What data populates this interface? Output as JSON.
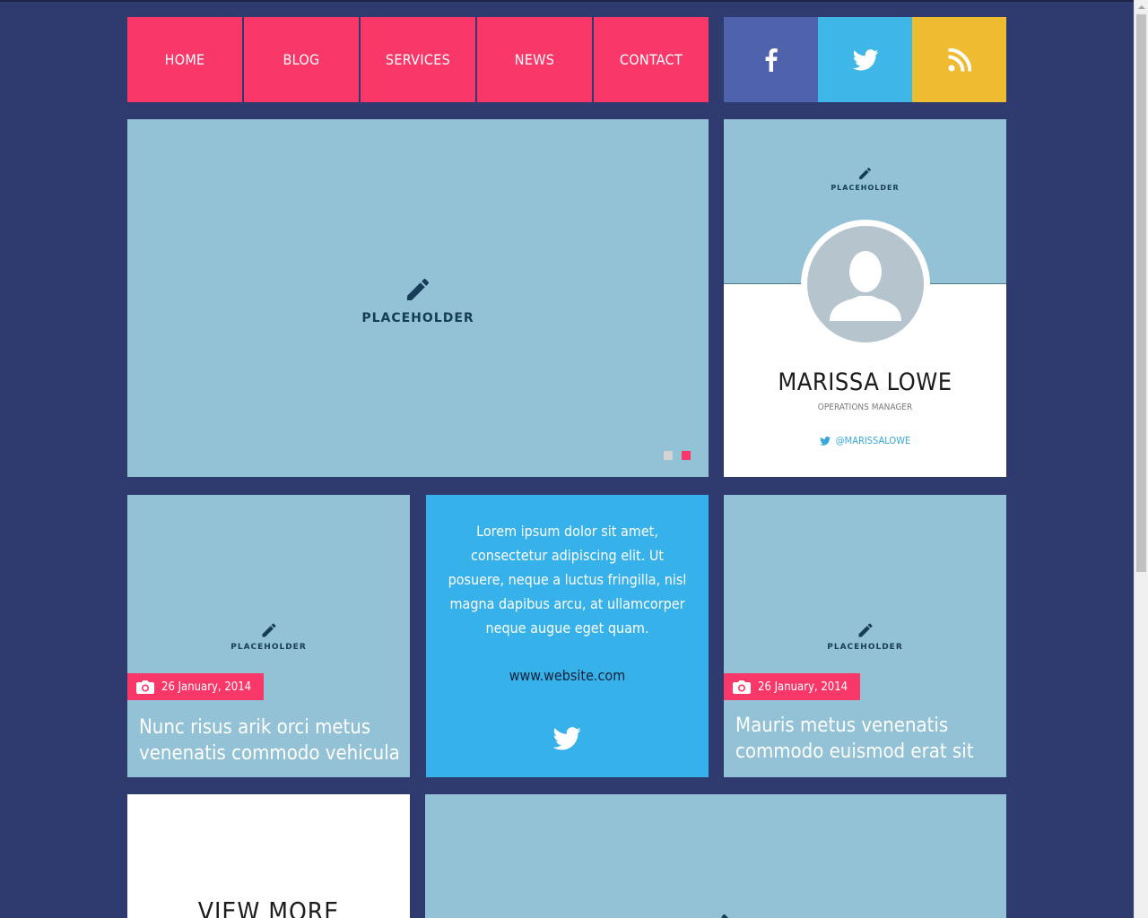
{
  "nav": {
    "items": [
      {
        "label": "HOME"
      },
      {
        "label": "BLOG"
      },
      {
        "label": "SERVICES"
      },
      {
        "label": "NEWS"
      },
      {
        "label": "CONTACT"
      }
    ]
  },
  "social": {
    "items": [
      {
        "icon": "facebook-icon",
        "color": "#4f63ad"
      },
      {
        "icon": "twitter-icon",
        "color": "#3fb6e8"
      },
      {
        "icon": "rss-icon",
        "color": "#eebb31"
      }
    ]
  },
  "hero": {
    "placeholder_label": "PLACEHOLDER",
    "slider_dots": [
      {
        "state": "inactive",
        "color": "#d3d3d3"
      },
      {
        "state": "active",
        "color": "#f93768"
      }
    ]
  },
  "profile": {
    "placeholder_label": "PLACEHOLDER",
    "name": "MARISSA LOWE",
    "role": "OPERATIONS MANAGER",
    "handle": "@MARISSALOWE"
  },
  "cards": [
    {
      "placeholder_label": "PLACEHOLDER",
      "date": "26 January, 2014",
      "title": "Nunc risus arik orci metus venenatis commodo vehicula"
    },
    {
      "placeholder_label": "PLACEHOLDER",
      "date": "26 January, 2014",
      "title": "Mauris metus venenatis commodo euismod erat sit"
    }
  ],
  "quote": {
    "text": "Lorem ipsum dolor sit amet, consectetur adipiscing elit. Ut posuere, neque a luctus fringilla, nisl magna dapibus arcu, at ullamcorper neque augue eget quam.",
    "url": "www.website.com"
  },
  "viewmore": {
    "label": "VIEW MORE"
  },
  "colors": {
    "background": "#2f3b6e",
    "accent": "#f93768",
    "tile": "#93c2d6",
    "quote": "#36b1ea",
    "placeholder_text": "#163c58"
  }
}
